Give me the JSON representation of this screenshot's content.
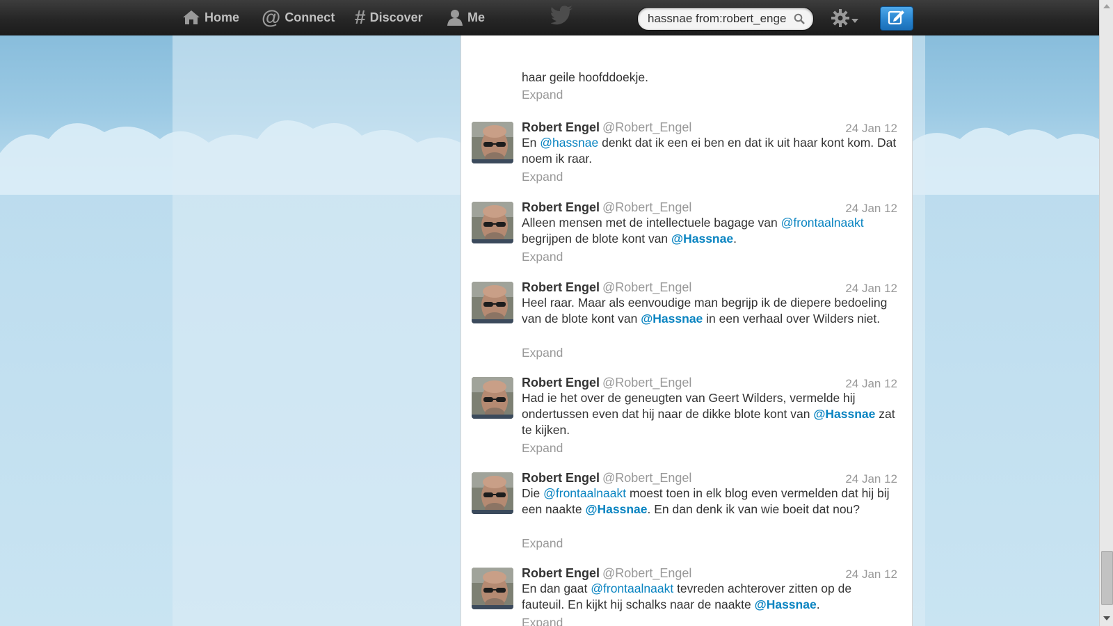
{
  "nav": {
    "home_label": "Home",
    "connect_label": "Connect",
    "discover_label": "Discover",
    "me_label": "Me"
  },
  "search": {
    "value": "hassnae from:robert_enge"
  },
  "colors": {
    "link": "#0a84c1",
    "compose_blue": "#2a85cf",
    "topbar": "#262626"
  },
  "timeline": {
    "first_partial": {
      "text": "haar geile hoofddoekje.",
      "expand_label": "Expand"
    },
    "tweets": [
      {
        "name": "Robert Engel",
        "handle": "@Robert_Engel",
        "time": "24 Jan 12",
        "text_parts": [
          {
            "t": "En ",
            "k": "plain"
          },
          {
            "t": "@hassnae",
            "k": "mention"
          },
          {
            "t": " denkt dat ik een ei ben en dat ik uit haar kont kom. Dat noem ik raar.",
            "k": "plain"
          }
        ],
        "expand_label": "Expand"
      },
      {
        "name": "Robert Engel",
        "handle": "@Robert_Engel",
        "time": "24 Jan 12",
        "text_parts": [
          {
            "t": "Alleen mensen met de intellectuele bagage van ",
            "k": "plain"
          },
          {
            "t": "@frontaalnaakt",
            "k": "mention"
          },
          {
            "t": " begrijpen de  blote kont van ",
            "k": "plain"
          },
          {
            "t": "@Hassnae",
            "k": "mention-bold"
          },
          {
            "t": ".",
            "k": "plain"
          }
        ],
        "expand_label": "Expand"
      },
      {
        "name": "Robert Engel",
        "handle": "@Robert_Engel",
        "time": "24 Jan 12",
        "text_parts": [
          {
            "t": "Heel raar. Maar als eenvoudige man begrijp ik de diepere bedoeling van de blote kont van ",
            "k": "plain"
          },
          {
            "t": "@Hassnae",
            "k": "mention-bold"
          },
          {
            "t": " in een verhaal over Wilders niet.",
            "k": "plain"
          }
        ],
        "expand_label": "Expand"
      },
      {
        "name": "Robert Engel",
        "handle": "@Robert_Engel",
        "time": "24 Jan 12",
        "text_parts": [
          {
            "t": "Had ie het over de geneugten van Geert Wilders, vermelde hij ondertussen even dat hij naar de dikke blote kont van ",
            "k": "plain"
          },
          {
            "t": "@Hassnae",
            "k": "mention-bold"
          },
          {
            "t": " zat te kijken.",
            "k": "plain"
          }
        ],
        "expand_label": "Expand"
      },
      {
        "name": "Robert Engel",
        "handle": "@Robert_Engel",
        "time": "24 Jan 12",
        "text_parts": [
          {
            "t": "Die ",
            "k": "plain"
          },
          {
            "t": "@frontaalnaakt",
            "k": "mention"
          },
          {
            "t": " moest toen in elk blog even vermelden dat hij bij een naakte ",
            "k": "plain"
          },
          {
            "t": "@Hassnae",
            "k": "mention-bold"
          },
          {
            "t": ". En dan denk ik van wie boeit dat nou?",
            "k": "plain"
          }
        ],
        "expand_label": "Expand"
      },
      {
        "name": "Robert Engel",
        "handle": "@Robert_Engel",
        "time": "24 Jan 12",
        "text_parts": [
          {
            "t": "En dan gaat ",
            "k": "plain"
          },
          {
            "t": "@frontaalnaakt",
            "k": "mention"
          },
          {
            "t": " tevreden achterover zitten op de fauteuil. En kijkt hij schalks naar de naakte ",
            "k": "plain"
          },
          {
            "t": "@Hassnae",
            "k": "mention-bold"
          },
          {
            "t": ".",
            "k": "plain"
          }
        ],
        "expand_label": "Expand"
      }
    ]
  }
}
